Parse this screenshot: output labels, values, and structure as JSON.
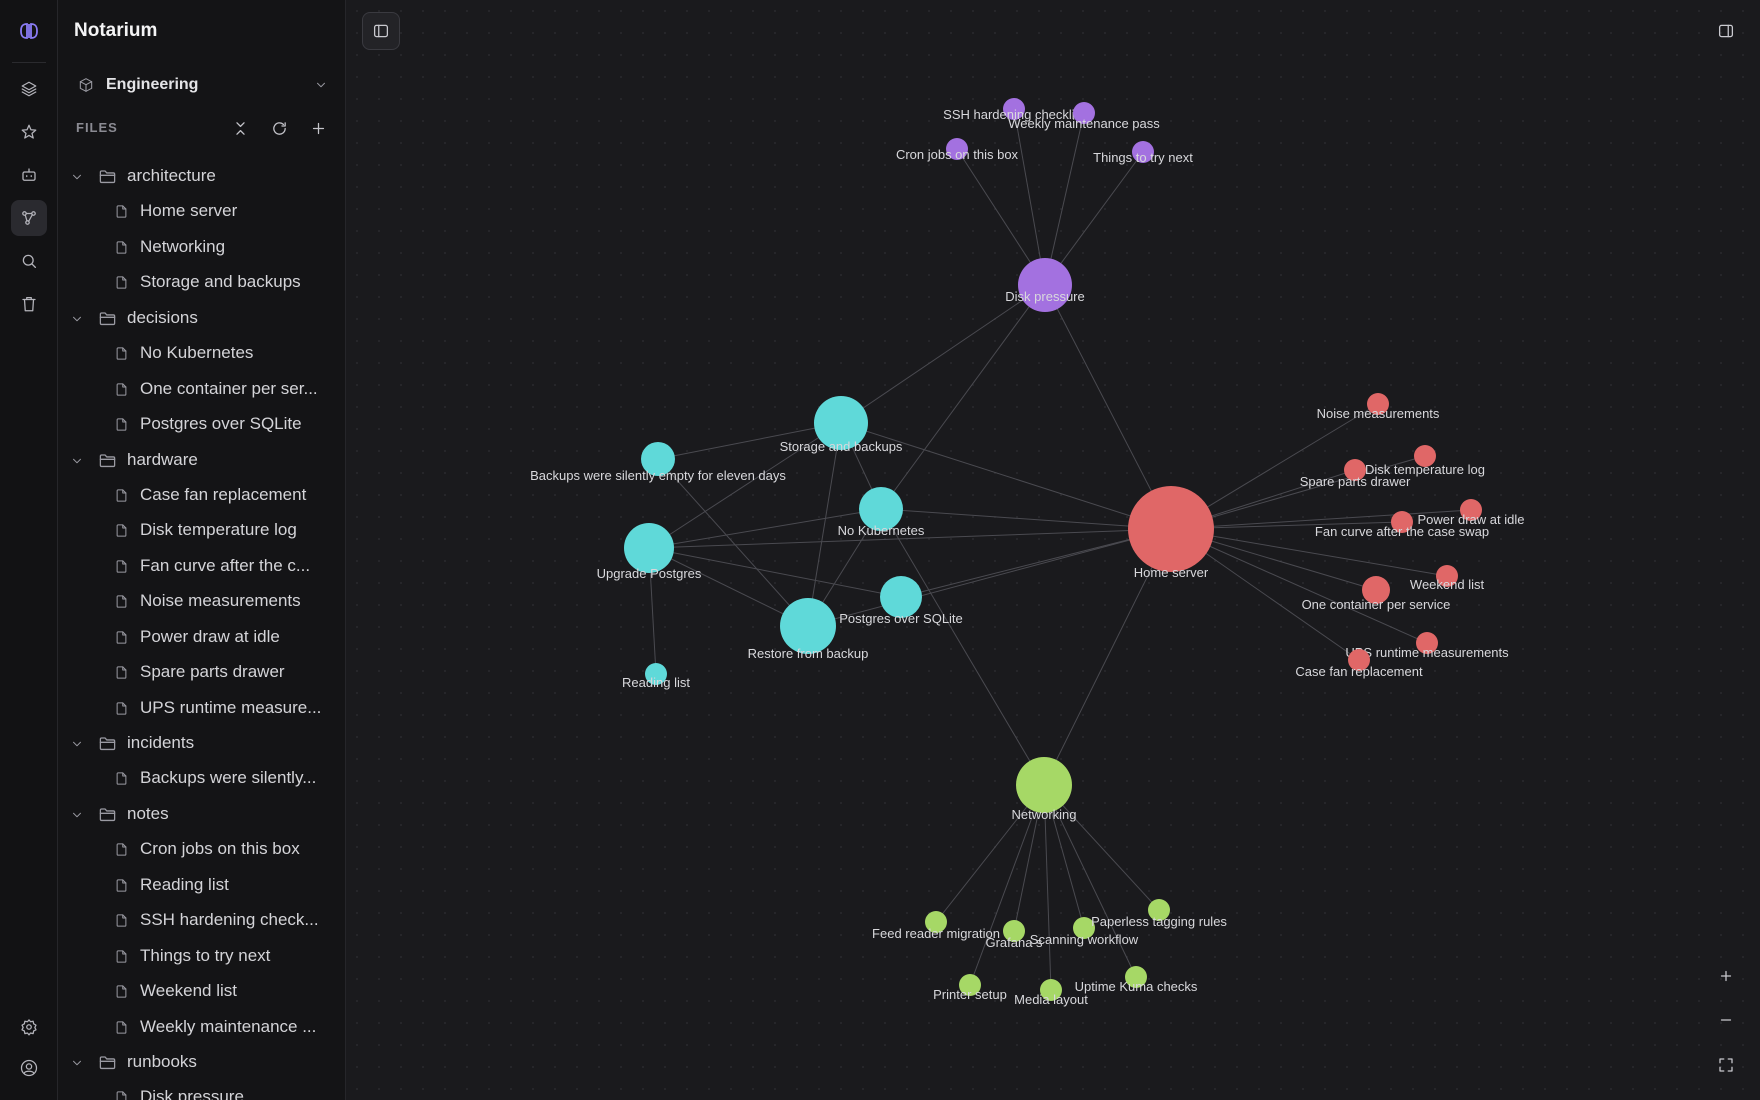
{
  "app": {
    "title": "Notarium"
  },
  "workspace": {
    "label": "Engineering"
  },
  "files_header": "FILES",
  "rail": [
    "collections-icon",
    "star-icon",
    "bot-icon",
    "graph-icon",
    "search-icon",
    "trash-icon",
    "settings-icon",
    "user-icon"
  ],
  "tree": [
    {
      "type": "folder",
      "label": "architecture"
    },
    {
      "type": "file",
      "label": "Home server"
    },
    {
      "type": "file",
      "label": "Networking"
    },
    {
      "type": "file",
      "label": "Storage and backups"
    },
    {
      "type": "folder",
      "label": "decisions"
    },
    {
      "type": "file",
      "label": "No Kubernetes"
    },
    {
      "type": "file",
      "label": "One container per ser..."
    },
    {
      "type": "file",
      "label": "Postgres over SQLite"
    },
    {
      "type": "folder",
      "label": "hardware"
    },
    {
      "type": "file",
      "label": "Case fan replacement"
    },
    {
      "type": "file",
      "label": "Disk temperature log"
    },
    {
      "type": "file",
      "label": "Fan curve after the c..."
    },
    {
      "type": "file",
      "label": "Noise measurements"
    },
    {
      "type": "file",
      "label": "Power draw at idle"
    },
    {
      "type": "file",
      "label": "Spare parts drawer"
    },
    {
      "type": "file",
      "label": "UPS runtime measure..."
    },
    {
      "type": "folder",
      "label": "incidents"
    },
    {
      "type": "file",
      "label": "Backups were silently..."
    },
    {
      "type": "folder",
      "label": "notes"
    },
    {
      "type": "file",
      "label": "Cron jobs on this box"
    },
    {
      "type": "file",
      "label": "Reading list"
    },
    {
      "type": "file",
      "label": "SSH hardening check..."
    },
    {
      "type": "file",
      "label": "Things to try next"
    },
    {
      "type": "file",
      "label": "Weekend list"
    },
    {
      "type": "file",
      "label": "Weekly maintenance ..."
    },
    {
      "type": "folder",
      "label": "runbooks"
    },
    {
      "type": "file",
      "label": "Disk pressure"
    }
  ],
  "graph": {
    "colors": {
      "purple": "#a371e0",
      "cyan": "#5fd9d9",
      "red": "#e06767",
      "green": "#a6d866",
      "edge": "#4a4a50"
    },
    "nodes": [
      {
        "id": "disk",
        "label": "Disk pressure",
        "group": "purple"
      },
      {
        "id": "ssh",
        "label": "SSH hardening checklist",
        "group": "purple"
      },
      {
        "id": "weekly",
        "label": "Weekly maintenance pass",
        "group": "purple"
      },
      {
        "id": "cron",
        "label": "Cron jobs on this box",
        "group": "purple"
      },
      {
        "id": "things",
        "label": "Things to try next",
        "group": "purple"
      },
      {
        "id": "storage",
        "label": "Storage and backups",
        "group": "cyan"
      },
      {
        "id": "backups",
        "label": "Backups were silently empty for eleven days",
        "group": "cyan"
      },
      {
        "id": "nok8s",
        "label": "No Kubernetes",
        "group": "cyan"
      },
      {
        "id": "upgrade",
        "label": "Upgrade Postgres",
        "group": "cyan"
      },
      {
        "id": "pgsqlite",
        "label": "Postgres over SQLite",
        "group": "cyan"
      },
      {
        "id": "restore",
        "label": "Restore from backup",
        "group": "cyan"
      },
      {
        "id": "reading",
        "label": "Reading list",
        "group": "cyan"
      },
      {
        "id": "home",
        "label": "Home server",
        "group": "red"
      },
      {
        "id": "noise",
        "label": "Noise measurements",
        "group": "red"
      },
      {
        "id": "disktemp",
        "label": "Disk temperature log",
        "group": "red"
      },
      {
        "id": "spare",
        "label": "Spare parts drawer",
        "group": "red"
      },
      {
        "id": "power",
        "label": "Power draw at idle",
        "group": "red"
      },
      {
        "id": "fancurve",
        "label": "Fan curve after the case swap",
        "group": "red"
      },
      {
        "id": "weekend",
        "label": "Weekend list",
        "group": "red"
      },
      {
        "id": "onecont",
        "label": "One container per service",
        "group": "red"
      },
      {
        "id": "ups",
        "label": "UPS runtime measurements",
        "group": "red"
      },
      {
        "id": "casefan",
        "label": "Case fan replacement",
        "group": "red"
      },
      {
        "id": "net",
        "label": "Networking",
        "group": "green"
      },
      {
        "id": "feed",
        "label": "Feed reader migration",
        "group": "green"
      },
      {
        "id": "grafana",
        "label": "Grafana s",
        "group": "green"
      },
      {
        "id": "scanning",
        "label": "Scanning workflow",
        "group": "green"
      },
      {
        "id": "paperless",
        "label": "Paperless tagging rules",
        "group": "green"
      },
      {
        "id": "printer",
        "label": "Printer setup",
        "group": "green"
      },
      {
        "id": "media",
        "label": "Media layout",
        "group": "green"
      },
      {
        "id": "uptime",
        "label": "Uptime Kuma checks",
        "group": "green"
      }
    ],
    "edges": [
      [
        "disk",
        "ssh"
      ],
      [
        "disk",
        "weekly"
      ],
      [
        "disk",
        "cron"
      ],
      [
        "disk",
        "things"
      ],
      [
        "disk",
        "storage"
      ],
      [
        "disk",
        "home"
      ],
      [
        "disk",
        "nok8s"
      ],
      [
        "storage",
        "backups"
      ],
      [
        "storage",
        "upgrade"
      ],
      [
        "storage",
        "home"
      ],
      [
        "storage",
        "restore"
      ],
      [
        "storage",
        "nok8s"
      ],
      [
        "nok8s",
        "home"
      ],
      [
        "nok8s",
        "upgrade"
      ],
      [
        "nok8s",
        "restore"
      ],
      [
        "nok8s",
        "net"
      ],
      [
        "upgrade",
        "pgsqlite"
      ],
      [
        "upgrade",
        "restore"
      ],
      [
        "upgrade",
        "reading"
      ],
      [
        "upgrade",
        "home"
      ],
      [
        "backups",
        "restore"
      ],
      [
        "pgsqlite",
        "home"
      ],
      [
        "restore",
        "home"
      ],
      [
        "home",
        "noise"
      ],
      [
        "home",
        "disktemp"
      ],
      [
        "home",
        "spare"
      ],
      [
        "home",
        "power"
      ],
      [
        "home",
        "fancurve"
      ],
      [
        "home",
        "weekend"
      ],
      [
        "home",
        "onecont"
      ],
      [
        "home",
        "ups"
      ],
      [
        "home",
        "casefan"
      ],
      [
        "home",
        "net"
      ],
      [
        "net",
        "feed"
      ],
      [
        "net",
        "grafana"
      ],
      [
        "net",
        "scanning"
      ],
      [
        "net",
        "paperless"
      ],
      [
        "net",
        "printer"
      ],
      [
        "net",
        "media"
      ],
      [
        "net",
        "uptime"
      ]
    ]
  }
}
